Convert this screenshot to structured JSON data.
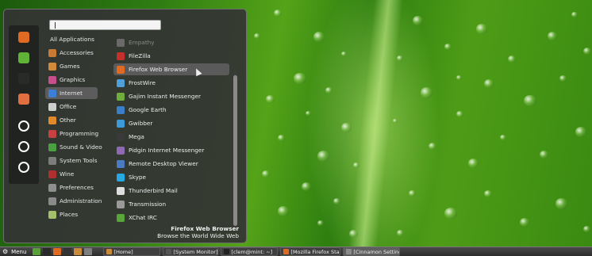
{
  "menu": {
    "search": {
      "value": "",
      "placeholder": ""
    },
    "favorites": [
      {
        "icon": "firefox-icon",
        "color": "#e06a22"
      },
      {
        "icon": "software-manager-icon",
        "color": "#5fb336"
      },
      {
        "icon": "terminal-icon",
        "color": "#2a2a2a"
      },
      {
        "icon": "search-tool-icon",
        "color": "#e07040"
      },
      {
        "icon": "lock-screen-icon",
        "color": "#ffffff"
      },
      {
        "icon": "logout-icon",
        "color": "#ffffff"
      },
      {
        "icon": "shutdown-icon",
        "color": "#ffffff"
      }
    ],
    "categories": [
      {
        "label": "All Applications",
        "icon": "",
        "color": ""
      },
      {
        "label": "Accessories",
        "icon": "accessories-icon",
        "color": "#c97a33"
      },
      {
        "label": "Games",
        "icon": "games-icon",
        "color": "#d28a3a"
      },
      {
        "label": "Graphics",
        "icon": "graphics-icon",
        "color": "#c84f8c"
      },
      {
        "label": "Internet",
        "icon": "internet-icon",
        "color": "#3d7ed8"
      },
      {
        "label": "Office",
        "icon": "office-icon",
        "color": "#cfcfcf"
      },
      {
        "label": "Other",
        "icon": "other-icon",
        "color": "#e08a2a"
      },
      {
        "label": "Programming",
        "icon": "programming-icon",
        "color": "#c94040"
      },
      {
        "label": "Sound & Video",
        "icon": "sound-video-icon",
        "color": "#4aa040"
      },
      {
        "label": "System Tools",
        "icon": "system-tools-icon",
        "color": "#7d7d7d"
      },
      {
        "label": "Wine",
        "icon": "wine-icon",
        "color": "#b03030"
      },
      {
        "label": "Preferences",
        "icon": "preferences-icon",
        "color": "#8f8f8f"
      },
      {
        "label": "Administration",
        "icon": "administration-icon",
        "color": "#8a8a8a"
      },
      {
        "label": "Places",
        "icon": "places-icon",
        "color": "#a4c06a"
      }
    ],
    "selected_category": "Internet",
    "apps": [
      {
        "label": "Empathy",
        "icon": "empathy-icon",
        "color": "#6a6a6a",
        "dim": true
      },
      {
        "label": "FileZilla",
        "icon": "filezilla-icon",
        "color": "#c4312b",
        "dim": false
      },
      {
        "label": "Firefox Web Browser",
        "icon": "firefox-icon",
        "color": "#e06a22",
        "dim": false
      },
      {
        "label": "FrostWire",
        "icon": "frostwire-icon",
        "color": "#4fa0d8",
        "dim": false
      },
      {
        "label": "Gajim Instant Messenger",
        "icon": "gajim-icon",
        "color": "#6fae3a",
        "dim": false
      },
      {
        "label": "Google Earth",
        "icon": "google-earth-icon",
        "color": "#3a7fc8",
        "dim": false
      },
      {
        "label": "Gwibber",
        "icon": "gwibber-icon",
        "color": "#3c9ad8",
        "dim": false
      },
      {
        "label": "Mega",
        "icon": "mega-icon",
        "color": "#3a3a3a",
        "dim": false
      },
      {
        "label": "Pidgin Internet Messenger",
        "icon": "pidgin-icon",
        "color": "#8e6ab3",
        "dim": false
      },
      {
        "label": "Remote Desktop Viewer",
        "icon": "remote-desktop-icon",
        "color": "#4b7bc2",
        "dim": false
      },
      {
        "label": "Skype",
        "icon": "skype-icon",
        "color": "#25a9e0",
        "dim": false
      },
      {
        "label": "Thunderbird Mail",
        "icon": "thunderbird-icon",
        "color": "#dddddd",
        "dim": false
      },
      {
        "label": "Transmission",
        "icon": "transmission-icon",
        "color": "#9a9a9a",
        "dim": false
      },
      {
        "label": "XChat IRC",
        "icon": "xchat-icon",
        "color": "#5aa53a",
        "dim": false
      }
    ],
    "hovered_app": "Firefox Web Browser",
    "description": {
      "title": "Firefox Web Browser",
      "subtitle": "Browse the World Wide Web"
    }
  },
  "panel": {
    "menu_label": "Menu",
    "launchers": [
      {
        "icon": "show-desktop-icon",
        "color": "#5aa03a"
      },
      {
        "icon": "terminal-icon",
        "color": "#2a2a2a"
      },
      {
        "icon": "firefox-icon",
        "color": "#e06a22"
      },
      {
        "icon": "terminal-icon",
        "color": "#333333"
      },
      {
        "icon": "files-icon",
        "color": "#c98a3c"
      },
      {
        "icon": "text-editor-icon",
        "color": "#7e7e7e"
      }
    ],
    "tasks": [
      {
        "label": "[Home]",
        "icon": "folder-icon",
        "color": "#c98a3c",
        "active": false
      },
      {
        "label": "[System Monitor]",
        "icon": "system-monitor-icon",
        "color": "#555555",
        "active": false
      },
      {
        "label": "[clem@mint: ~]",
        "icon": "terminal-icon",
        "color": "#222222",
        "active": false
      },
      {
        "label": "[Mozilla Firefox Start...",
        "icon": "firefox-icon",
        "color": "#e06a22",
        "active": false
      },
      {
        "label": "[Cinnamon Settings]",
        "icon": "settings-icon",
        "color": "#8a8a8a",
        "active": true
      }
    ]
  }
}
